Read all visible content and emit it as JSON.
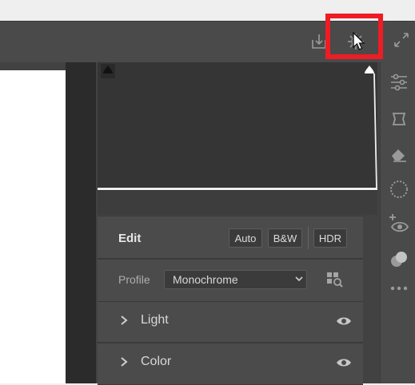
{
  "edit_panel": {
    "title": "Edit",
    "auto_label": "Auto",
    "bw_label": "B&W",
    "hdr_label": "HDR",
    "profile_label": "Profile",
    "profile_value": "Monochrome"
  },
  "sections": {
    "light_label": "Light",
    "color_label": "Color"
  },
  "toolbar": {
    "icons": [
      "export-icon",
      "settings-gear-icon",
      "expand-icon"
    ]
  },
  "right_rail": {
    "icons": [
      "edit-sliders-icon",
      "crop-icon",
      "eraser-icon",
      "selection-circle-icon",
      "redeye-icon",
      "mask-icon",
      "more-icon"
    ]
  },
  "colors": {
    "highlight": "#ee1c24",
    "panel_bg": "#424242",
    "toolbar_bg": "#4a4a4a"
  }
}
